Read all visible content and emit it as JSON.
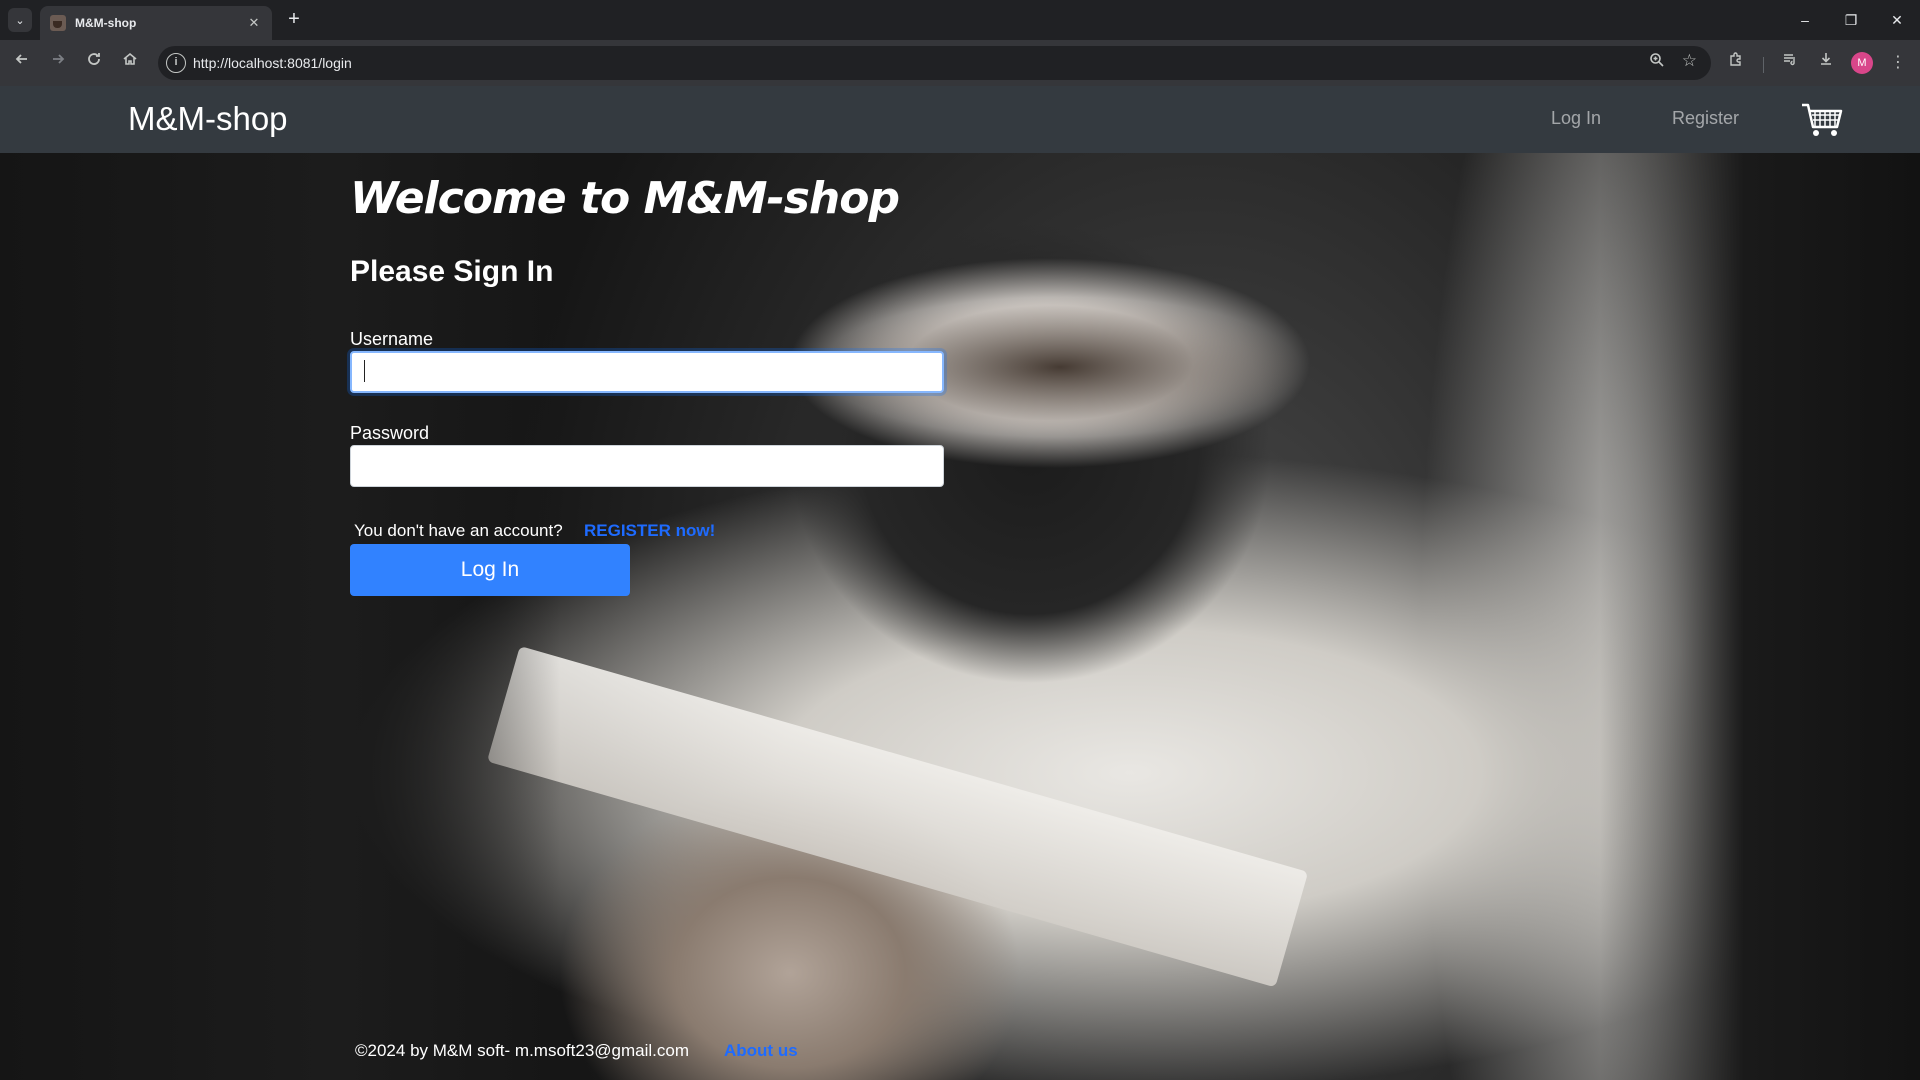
{
  "browser": {
    "tab_title": "M&M-shop",
    "tab_close": "✕",
    "new_tab": "+",
    "url": "http://localhost:8081/login",
    "profile_initial": "M",
    "window_controls": {
      "minimize": "–",
      "restore": "❐",
      "close": "✕"
    }
  },
  "navbar": {
    "brand": "M&M-shop",
    "login_link": "Log In",
    "register_link": "Register",
    "cart_icon": "shopping-cart-icon"
  },
  "main": {
    "welcome": "Welcome to M&M-shop",
    "sign_in_title": "Please Sign In",
    "username_label": "Username",
    "username_value": "",
    "password_label": "Password",
    "password_value": "",
    "no_account_text": "You don't have an account?",
    "register_now": "REGISTER now!",
    "login_button": "Log In"
  },
  "footer": {
    "copyright": "©2024 by M&M soft- m.msoft23@gmail.com",
    "about_us": "About us"
  },
  "colors": {
    "navbar_bg": "#343a40",
    "primary_button": "#3182ff",
    "link_blue": "#1e6bff",
    "browser_frame": "#202124",
    "browser_toolbar": "#35363a"
  }
}
